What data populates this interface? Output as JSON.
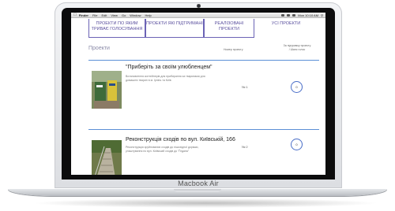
{
  "device": {
    "brand_label": "Macbook Air"
  },
  "menubar": {
    "apple_icon": "apple-icon",
    "items": [
      {
        "label": "Finder",
        "bold": true
      },
      {
        "label": "File"
      },
      {
        "label": "Edit"
      },
      {
        "label": "View"
      },
      {
        "label": "Go"
      },
      {
        "label": "Window"
      },
      {
        "label": "Help"
      }
    ],
    "clock": "Mon 10:10 AM"
  },
  "tabs": [
    {
      "label": "ПРОЕКТИ ПО ЯКИМ ТРИВАЄ ГОЛОСУВАННЯ",
      "active": true
    },
    {
      "label": "ПРОЕКТИ ЯКІ ПІДТРИМАНІ"
    },
    {
      "label": "РЕАЛІЗОВАНІ ПРОЕКТИ"
    },
    {
      "label": "УСІ ПРОЕКТИ"
    }
  ],
  "table_header": {
    "projects": "Проекти",
    "votes": "Номер проекту",
    "support": "За підтримку проекту / Шанс голос"
  },
  "projects": [
    {
      "title": "\"Приберіть за своїм улюбленцем\"",
      "description": "Встановлення контейнерів для прибирання за тваринами для домашніх тварин в м. Ірпінь та Київ",
      "number": "№ 1",
      "votes": "0",
      "image_icon": "trash-bins-photo"
    },
    {
      "title": "Реконструкція сходів по вул. Київській, 166",
      "description": "Реконструкція зруйнованих сходів до пішохідної доріжки, улаштування по вул. Київській сходів до \"Ґедана\"",
      "number": "№ 2",
      "votes": "0",
      "image_icon": "stairs-photo"
    }
  ],
  "colors": {
    "accent": "#6b63b5",
    "divider": "#5b8fd6",
    "circle": "#4b6fc8"
  }
}
